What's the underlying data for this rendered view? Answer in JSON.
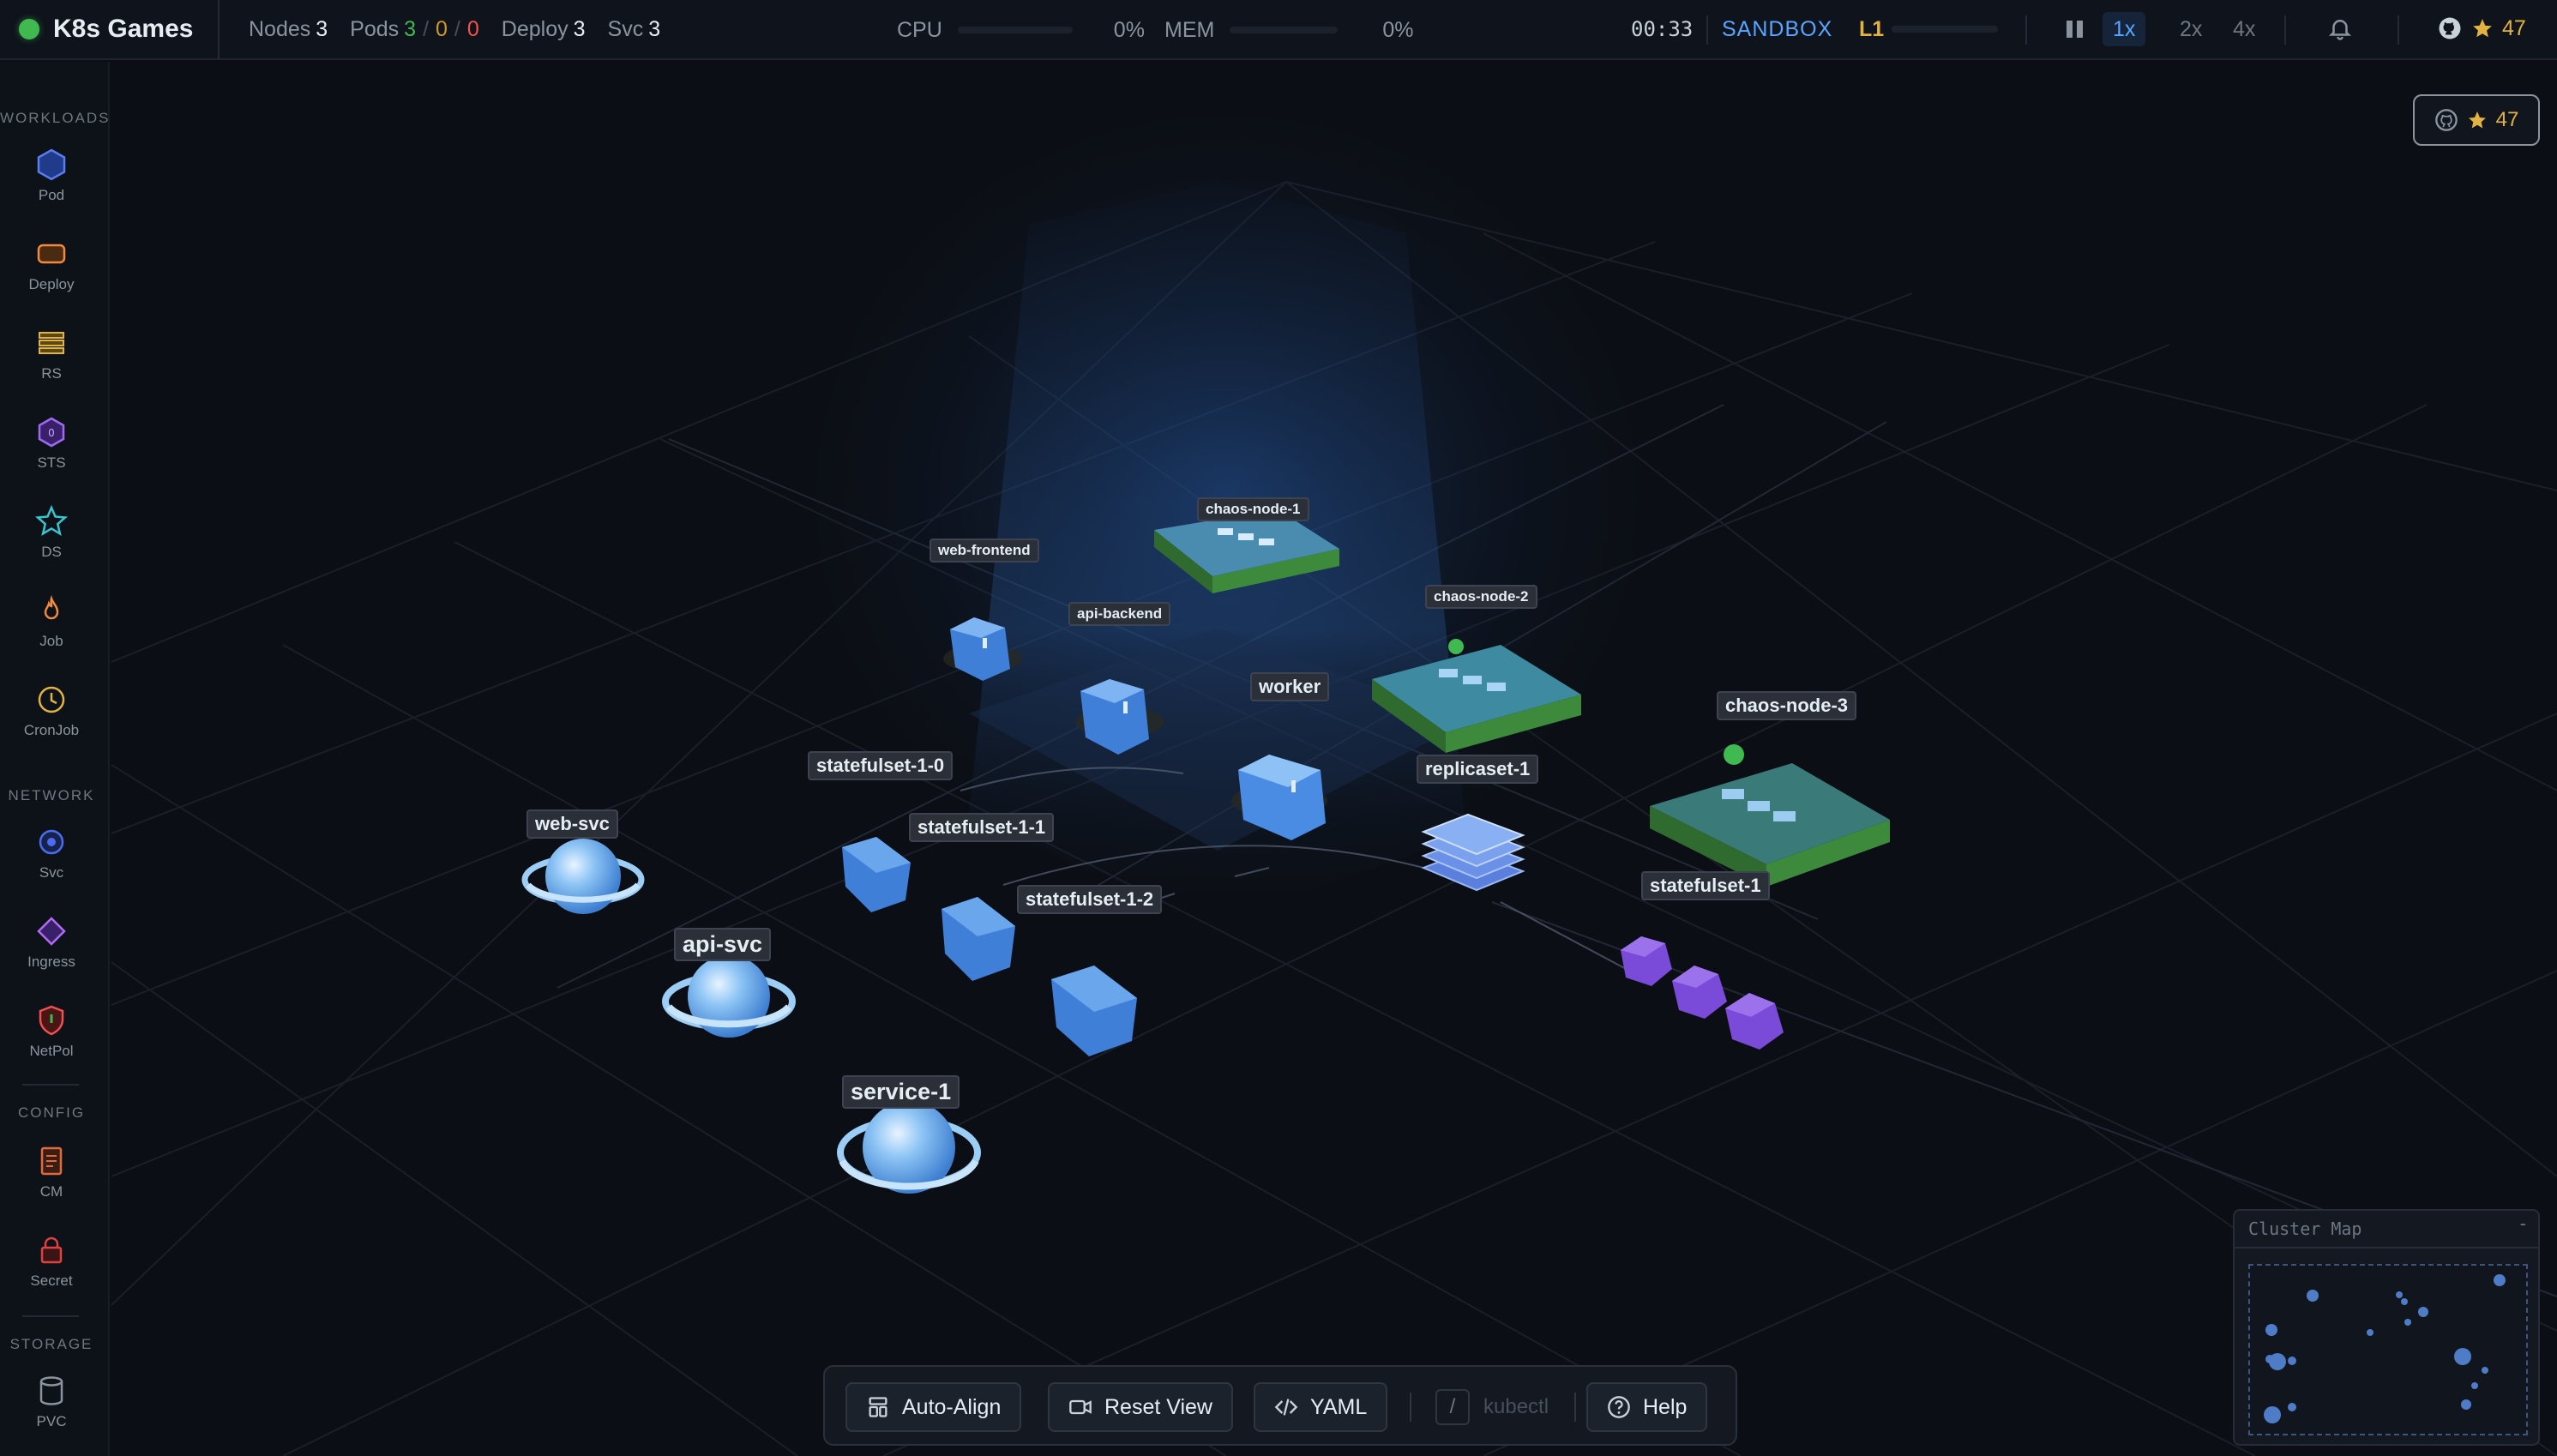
{
  "app": {
    "title": "K8s Games"
  },
  "stats": {
    "nodes_label": "Nodes",
    "nodes_value": "3",
    "pods_label": "Pods",
    "pods_running": "3",
    "pods_pending": "0",
    "pods_failed": "0",
    "pods_sep": "/",
    "deploy_label": "Deploy",
    "deploy_value": "3",
    "svc_label": "Svc",
    "svc_value": "3"
  },
  "meters": {
    "cpu_label": "CPU",
    "cpu_value": "0%",
    "cpu_level": 0,
    "mem_label": "MEM",
    "mem_value": "0%",
    "mem_level": 0
  },
  "timer": "00:33",
  "mode": "SANDBOX",
  "level": {
    "label": "L1",
    "progress": 0
  },
  "speeds": [
    "1x",
    "2x",
    "4x"
  ],
  "active_speed": "1x",
  "github": {
    "stars": "47"
  },
  "sidebar": {
    "sections": {
      "workloads": "WORKLOADS",
      "network": "NETWORK",
      "config": "CONFIG",
      "storage": "STORAGE"
    },
    "workloads": [
      {
        "label": "Pod",
        "icon": "hexagon-icon"
      },
      {
        "label": "Deploy",
        "icon": "rounded-rect-icon"
      },
      {
        "label": "RS",
        "icon": "stacked-layers-icon"
      },
      {
        "label": "STS",
        "icon": "numbered-hexagon-icon"
      },
      {
        "label": "DS",
        "icon": "star-icon"
      },
      {
        "label": "Job",
        "icon": "flame-icon"
      },
      {
        "label": "CronJob",
        "icon": "clock-icon"
      }
    ],
    "network": [
      {
        "label": "Svc",
        "icon": "circle-dot-icon"
      },
      {
        "label": "Ingress",
        "icon": "diamond-icon"
      },
      {
        "label": "NetPol",
        "icon": "shield-icon"
      }
    ],
    "config": [
      {
        "label": "CM",
        "icon": "document-icon"
      },
      {
        "label": "Secret",
        "icon": "lock-icon"
      }
    ],
    "storage": [
      {
        "label": "PVC",
        "icon": "cylinder-icon"
      }
    ],
    "sts_badge": "0"
  },
  "scene": {
    "nodes": [
      "chaos-node-1",
      "chaos-node-2",
      "chaos-node-3"
    ],
    "deployments": [
      "web-frontend",
      "api-backend",
      "worker"
    ],
    "statefulset_pods": [
      "statefulset-1-0",
      "statefulset-1-1",
      "statefulset-1-2"
    ],
    "replicaset": "replicaset-1",
    "statefulset": "statefulset-1",
    "services": [
      "web-svc",
      "api-svc",
      "service-1"
    ]
  },
  "toolbar": {
    "auto_align": "Auto-Align",
    "reset_view": "Reset View",
    "yaml": "YAML",
    "kubectl_key": "/",
    "kubectl_placeholder": "kubectl",
    "help": "Help"
  },
  "cluster_map": {
    "title": "Cluster Map",
    "minimize": "-"
  },
  "colors": {
    "accent": "#58a6ff",
    "running": "#3fb950",
    "pending": "#d29922",
    "failed": "#f85149",
    "star": "#e3b341"
  }
}
